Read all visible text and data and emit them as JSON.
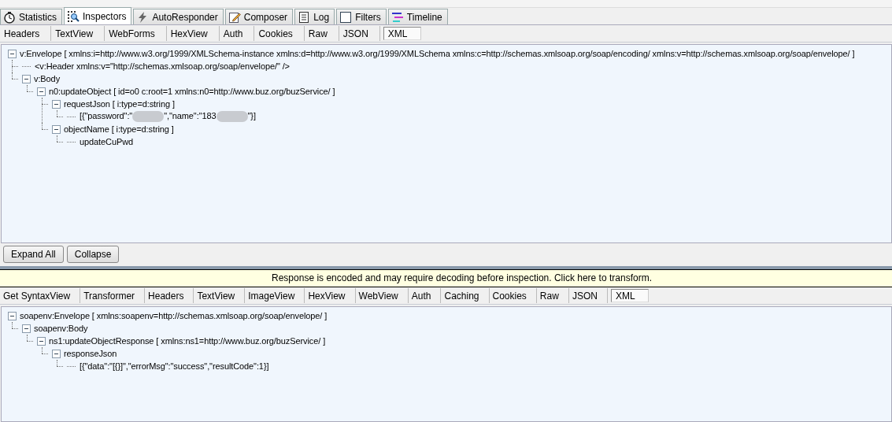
{
  "main_tabs": [
    {
      "label": "Statistics",
      "selected": false
    },
    {
      "label": "Inspectors",
      "selected": true
    },
    {
      "label": "AutoResponder",
      "selected": false
    },
    {
      "label": "Composer",
      "selected": false
    },
    {
      "label": "Log",
      "selected": false
    },
    {
      "label": "Filters",
      "selected": false
    },
    {
      "label": "Timeline",
      "selected": false
    }
  ],
  "request": {
    "tabs": [
      {
        "label": "Headers",
        "selected": false
      },
      {
        "label": "TextView",
        "selected": false
      },
      {
        "label": "WebForms",
        "selected": false
      },
      {
        "label": "HexView",
        "selected": false
      },
      {
        "label": "Auth",
        "selected": false
      },
      {
        "label": "Cookies",
        "selected": false
      },
      {
        "label": "Raw",
        "selected": false
      },
      {
        "label": "JSON",
        "selected": false
      },
      {
        "label": "XML",
        "selected": true
      }
    ],
    "tree": [
      {
        "text": "v:Envelope [ xmlns:i=http://www.w3.org/1999/XMLSchema-instance xmlns:d=http://www.w3.org/1999/XMLSchema xmlns:c=http://schemas.xmlsoap.org/soap/encoding/ xmlns:v=http://schemas.xmlsoap.org/soap/envelope/ ]",
        "expanded": true,
        "children": [
          {
            "text": "<v:Header xmlns:v=\"http://schemas.xmlsoap.org/soap/envelope/\" />"
          },
          {
            "text": "v:Body",
            "expanded": true,
            "children": [
              {
                "text": "n0:updateObject [ id=o0 c:root=1 xmlns:n0=http://www.buz.org/buzService/ ]",
                "expanded": true,
                "children": [
                  {
                    "text": "requestJson [ i:type=d:string ]",
                    "expanded": true,
                    "children": [
                      {
                        "parts": [
                          "[{\"password\":\"",
                          "\",\"name\":\"183",
                          "\"}]"
                        ]
                      }
                    ]
                  },
                  {
                    "text": "objectName [ i:type=d:string ]",
                    "expanded": true,
                    "children": [
                      {
                        "text": "updateCuPwd"
                      }
                    ]
                  }
                ]
              }
            ]
          }
        ]
      }
    ],
    "buttons": [
      "Expand All",
      "Collapse"
    ]
  },
  "response": {
    "banner": "Response is encoded and may require decoding before inspection. Click here to transform.",
    "tabs": [
      {
        "label": "Get SyntaxView",
        "selected": false
      },
      {
        "label": "Transformer",
        "selected": false
      },
      {
        "label": "Headers",
        "selected": false
      },
      {
        "label": "TextView",
        "selected": false
      },
      {
        "label": "ImageView",
        "selected": false
      },
      {
        "label": "HexView",
        "selected": false
      },
      {
        "label": "WebView",
        "selected": false
      },
      {
        "label": "Auth",
        "selected": false
      },
      {
        "label": "Caching",
        "selected": false
      },
      {
        "label": "Cookies",
        "selected": false
      },
      {
        "label": "Raw",
        "selected": false
      },
      {
        "label": "JSON",
        "selected": false
      },
      {
        "label": "XML",
        "selected": true
      }
    ],
    "tree": [
      {
        "text": "soapenv:Envelope [ xmlns:soapenv=http://schemas.xmlsoap.org/soap/envelope/ ]",
        "expanded": true,
        "children": [
          {
            "text": "soapenv:Body",
            "expanded": true,
            "children": [
              {
                "text": "ns1:updateObjectResponse [ xmlns:ns1=http://www.buz.org/buzService/ ]",
                "expanded": true,
                "children": [
                  {
                    "text": "responseJson",
                    "expanded": true,
                    "children": [
                      {
                        "text": "[{\"data\":\"[{}]\",\"errorMsg\":\"success\",\"resultCode\":1}]"
                      }
                    ]
                  }
                ]
              }
            ]
          }
        ]
      }
    ]
  }
}
